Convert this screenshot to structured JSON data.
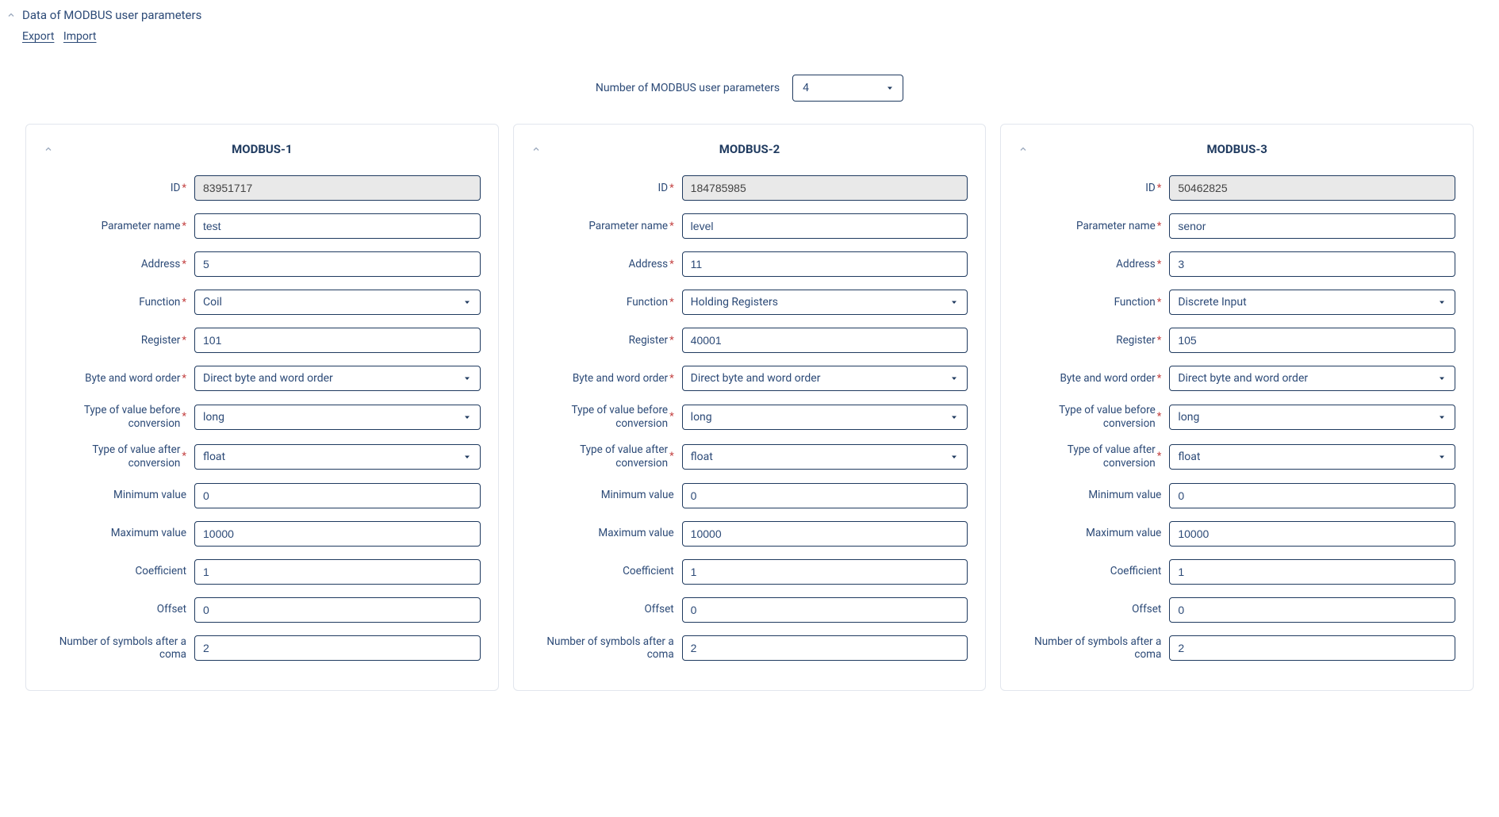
{
  "header": {
    "title": "Data of MODBUS user parameters",
    "export": "Export",
    "import": "Import"
  },
  "count": {
    "label": "Number of MODBUS user parameters",
    "value": "4"
  },
  "labels": {
    "id": "ID",
    "param_name": "Parameter name",
    "address": "Address",
    "function": "Function",
    "register": "Register",
    "byte_order": "Byte and word order",
    "type_before": "Type of value before conversion",
    "type_after": "Type of value after conversion",
    "min": "Minimum value",
    "max": "Maximum value",
    "coef": "Coefficient",
    "offset": "Offset",
    "symbols": "Number of symbols after a coma"
  },
  "cards": [
    {
      "title": "MODBUS-1",
      "id": "83951717",
      "param_name": "test",
      "address": "5",
      "function": "Coil",
      "register": "101",
      "byte_order": "Direct byte and word order",
      "type_before": "long",
      "type_after": "float",
      "min": "0",
      "max": "10000",
      "coef": "1",
      "offset": "0",
      "symbols": "2"
    },
    {
      "title": "MODBUS-2",
      "id": "184785985",
      "param_name": "level",
      "address": "11",
      "function": "Holding Registers",
      "register": "40001",
      "byte_order": "Direct byte and word order",
      "type_before": "long",
      "type_after": "float",
      "min": "0",
      "max": "10000",
      "coef": "1",
      "offset": "0",
      "symbols": "2"
    },
    {
      "title": "MODBUS-3",
      "id": "50462825",
      "param_name": "senor",
      "address": "3",
      "function": "Discrete Input",
      "register": "105",
      "byte_order": "Direct byte and word order",
      "type_before": "long",
      "type_after": "float",
      "min": "0",
      "max": "10000",
      "coef": "1",
      "offset": "0",
      "symbols": "2"
    }
  ]
}
